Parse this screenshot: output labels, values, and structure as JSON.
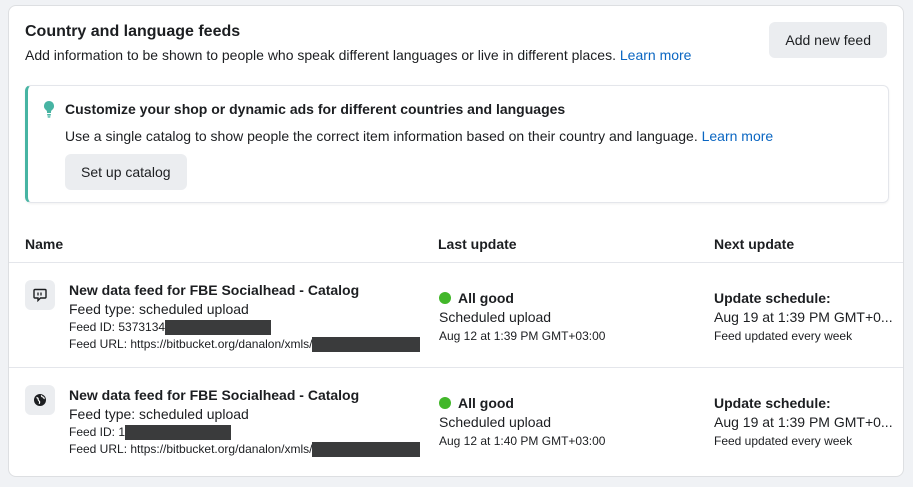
{
  "header": {
    "title": "Country and language feeds",
    "subtitle": "Add information to be shown to people who speak different languages or live in different places.",
    "learn_more": "Learn more",
    "add_feed_label": "Add new feed"
  },
  "banner": {
    "title": "Customize your shop or dynamic ads for different countries and languages",
    "text": "Use a single catalog to show people the correct item information based on their country and language.",
    "learn_more": "Learn more",
    "setup_label": "Set up catalog",
    "accent_color": "#47b4a3"
  },
  "table": {
    "columns": [
      "Name",
      "Last update",
      "Next update"
    ],
    "rows": [
      {
        "icon": "speech-bubble-icon",
        "name": "New data feed for FBE Socialhead - Catalog",
        "type": "Feed type: scheduled upload",
        "id": "Feed ID: 5373134",
        "url": "Feed URL: https://bitbucket.org/danalon/xmls/",
        "status": "All good",
        "status_color": "#42b72a",
        "status_detail": "Scheduled upload",
        "last_date": "Aug 12 at 1:39 PM GMT+03:00",
        "next_title": "Update schedule:",
        "next_time": "Aug 19 at 1:39 PM GMT+0...",
        "next_note": "Feed updated every week"
      },
      {
        "icon": "globe-icon",
        "name": "New data feed for FBE Socialhead - Catalog",
        "type": "Feed type: scheduled upload",
        "id": "Feed ID: 1",
        "url": "Feed URL: https://bitbucket.org/danalon/xmls/",
        "status": "All good",
        "status_color": "#42b72a",
        "status_detail": "Scheduled upload",
        "last_date": "Aug 12 at 1:40 PM GMT+03:00",
        "next_title": "Update schedule:",
        "next_time": "Aug 19 at 1:39 PM GMT+0...",
        "next_note": "Feed updated every week"
      }
    ]
  }
}
